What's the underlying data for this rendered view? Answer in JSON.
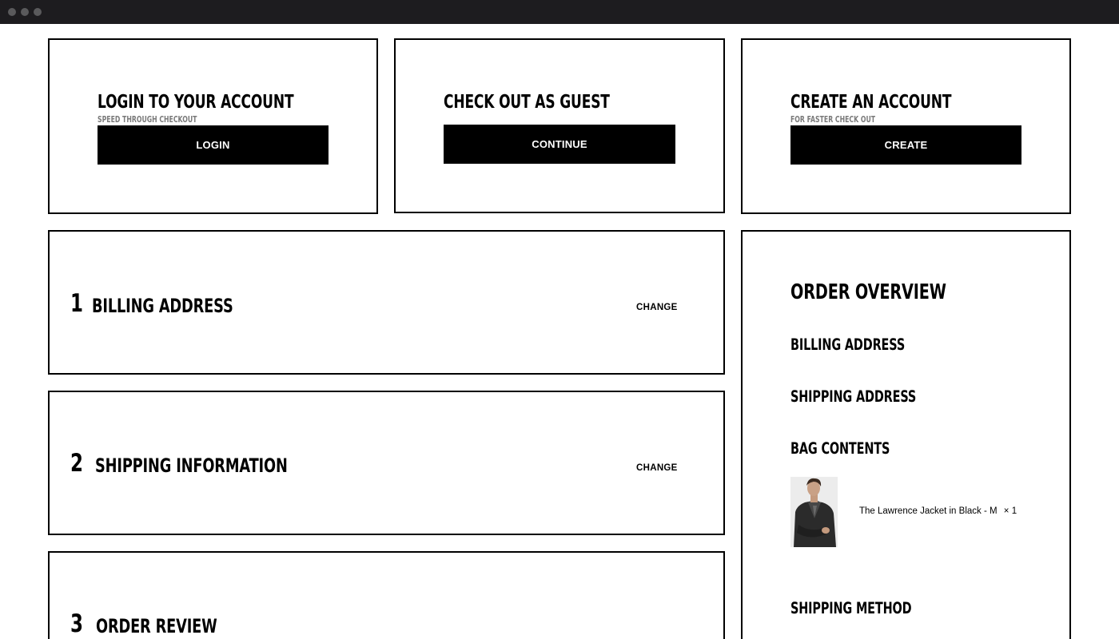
{
  "login_card": {
    "title": "LOGIN TO YOUR ACCOUNT",
    "subtitle": "SPEED THROUGH CHECKOUT",
    "button": "LOGIN"
  },
  "guest_card": {
    "title": "CHECK OUT AS GUEST",
    "button": "CONTINUE"
  },
  "create_card": {
    "title": "CREATE AN ACCOUNT",
    "subtitle": "FOR FASTER CHECK OUT",
    "button": "CREATE"
  },
  "steps": [
    {
      "number": "1",
      "title": "BILLING ADDRESS",
      "action": "CHANGE"
    },
    {
      "number": "2",
      "title": "SHIPPING INFORMATION",
      "action": "CHANGE"
    },
    {
      "number": "3",
      "title": "ORDER REVIEW"
    }
  ],
  "overview": {
    "title": "ORDER OVERVIEW",
    "billing_heading": "BILLING ADDRESS",
    "shipping_heading": "SHIPPING ADDRESS",
    "bag_heading": "BAG CONTENTS",
    "item": {
      "name": "The Lawrence Jacket in Black - M",
      "quantity": "× 1"
    },
    "shipping_method_heading": "SHIPPING METHOD"
  }
}
